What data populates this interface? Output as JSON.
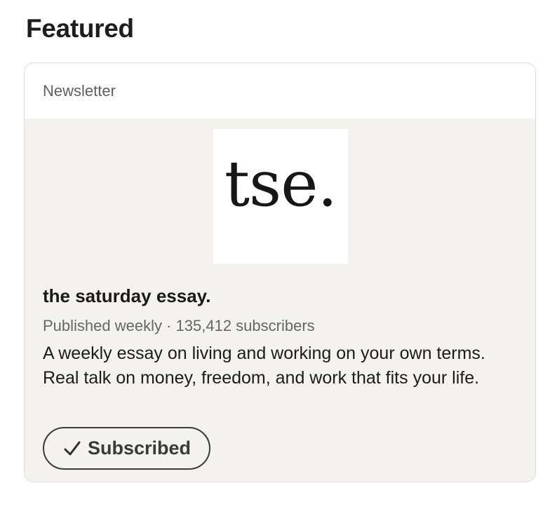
{
  "section": {
    "title": "Featured"
  },
  "card": {
    "type_label": "Newsletter",
    "logo_text": "tse.",
    "newsletter_title": "the saturday essay.",
    "meta": "Published weekly · 135,412 subscribers",
    "description": "A weekly essay on living and working on your own terms. Real talk on money, freedom, and work that fits your life.",
    "subscribe_button": {
      "label": "Subscribed",
      "icon": "check-icon"
    }
  }
}
